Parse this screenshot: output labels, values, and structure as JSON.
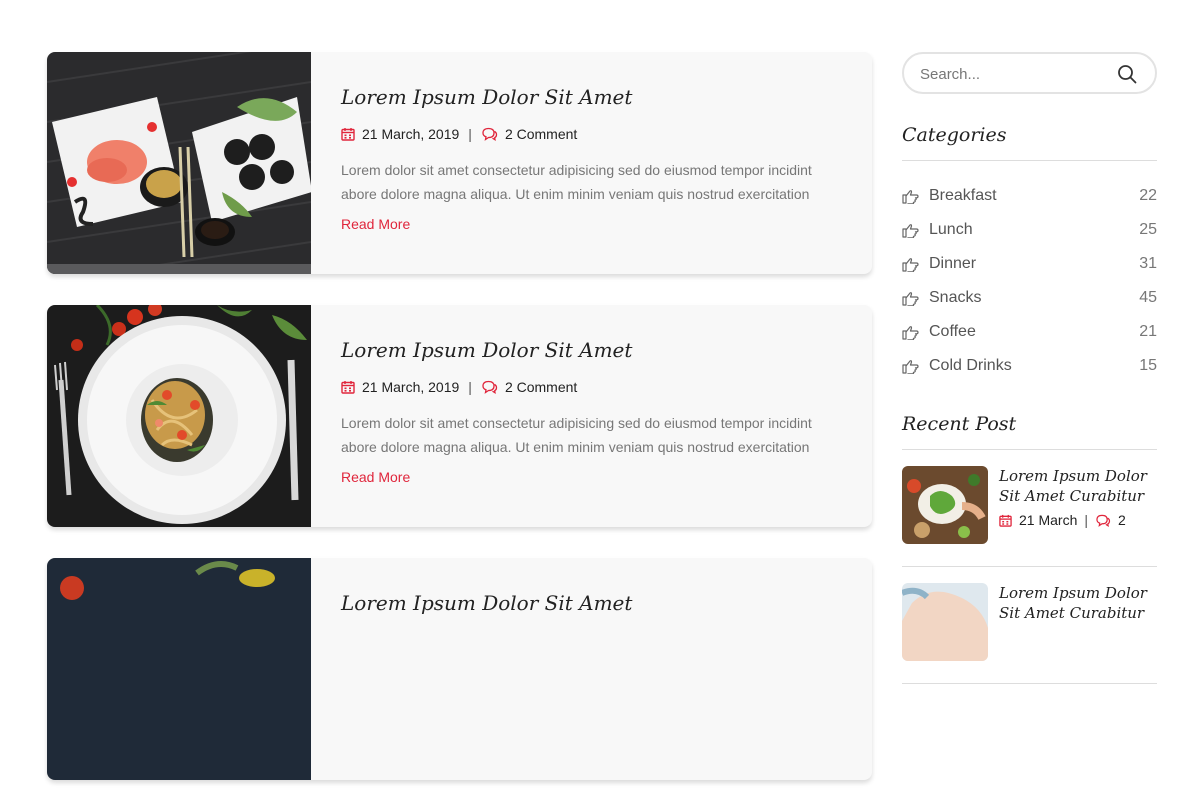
{
  "posts": [
    {
      "title": "Lorem Ipsum Dolor Sit Amet",
      "date": "21 March, 2019",
      "comments": "2 Comment",
      "excerpt": "Lorem dolor sit amet consectetur adipisicing sed do eiusmod tempor incidint abore dolore magna aliqua. Ut enim minim veniam quis nostrud exercitation",
      "read_more": "Read More",
      "image_icon": "sushi-plates-image"
    },
    {
      "title": "Lorem Ipsum Dolor Sit Amet",
      "date": "21 March, 2019",
      "comments": "2 Comment",
      "excerpt": "Lorem dolor sit amet consectetur adipisicing sed do eiusmod tempor incidint abore dolore magna aliqua. Ut enim minim veniam quis nostrud exercitation",
      "read_more": "Read More",
      "image_icon": "pasta-plate-image"
    },
    {
      "title": "Lorem Ipsum Dolor Sit Amet",
      "image_icon": "dark-table-image"
    }
  ],
  "sidebar": {
    "search_placeholder": "Search...",
    "categories_title": "Categories",
    "categories": [
      {
        "label": "Breakfast",
        "count": "22"
      },
      {
        "label": "Lunch",
        "count": "25"
      },
      {
        "label": "Dinner",
        "count": "31"
      },
      {
        "label": "Snacks",
        "count": "45"
      },
      {
        "label": "Coffee",
        "count": "21"
      },
      {
        "label": "Cold Drinks",
        "count": "15"
      }
    ],
    "recent_title": "Recent Post",
    "recent": [
      {
        "title": "Lorem Ipsum Dolor Sit Amet Curabitur",
        "date": "21 March",
        "comments": "2"
      },
      {
        "title": "Lorem Ipsum Dolor Sit Amet Curabitur"
      }
    ]
  },
  "colors": {
    "accent": "#e0263c",
    "text": "#222222",
    "muted": "#777777"
  }
}
